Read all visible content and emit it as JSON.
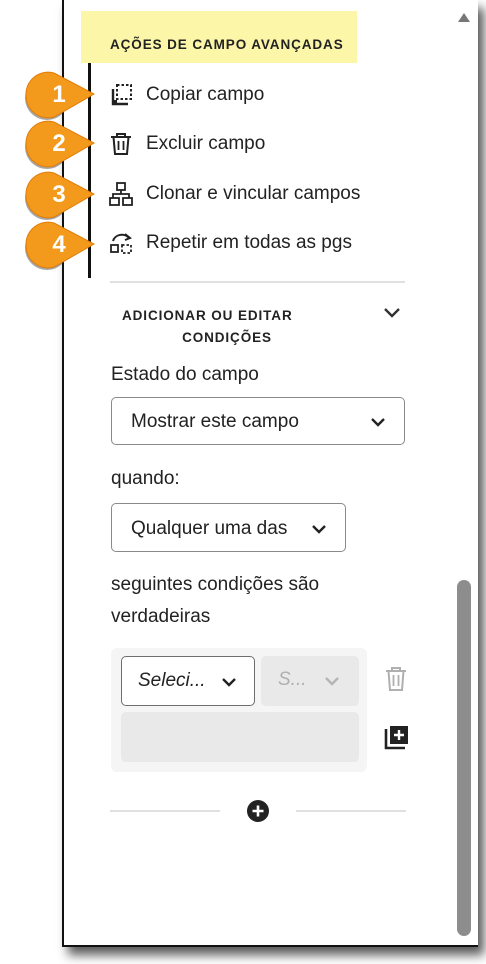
{
  "advanced": {
    "title": "AÇÕES DE CAMPO AVANÇADAS",
    "highlight_color": "#fbf6a8",
    "actions": [
      {
        "badge": "1",
        "label": "Copiar campo",
        "icon": "copy-field-icon"
      },
      {
        "badge": "2",
        "label": "Excluir campo",
        "icon": "trash-icon"
      },
      {
        "badge": "3",
        "label": "Clonar e vincular campos",
        "icon": "clone-link-icon"
      },
      {
        "badge": "4",
        "label": "Repetir em todas as pgs",
        "icon": "repeat-pages-icon"
      }
    ],
    "badge_color": "#f39a1c"
  },
  "conditions": {
    "title_line1": "ADICIONAR OU EDITAR",
    "title_line2": "CONDIÇÕES",
    "field_state_label": "Estado do campo",
    "field_state_value": "Mostrar este campo",
    "when_label": "quando:",
    "match_value": "Qualquer uma das",
    "suffix_line1": "seguintes condições são",
    "suffix_line2": "verdadeiras",
    "row": {
      "field_select": "Seleci...",
      "state_select": "S...",
      "value": ""
    }
  },
  "icons": [
    "chevron-down-icon",
    "trash-icon",
    "add-condition-icon",
    "plus-circle-icon",
    "scroll-up-icon"
  ]
}
